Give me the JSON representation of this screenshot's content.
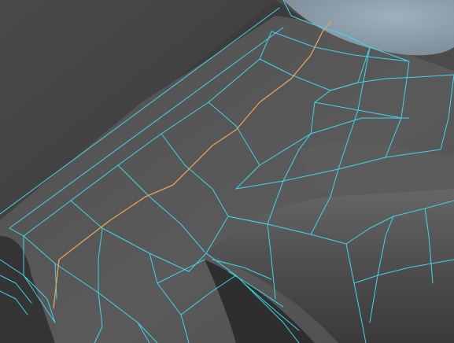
{
  "viewport": {
    "kind": "3d-viewport-wireframe-on-shaded",
    "colors": {
      "background": "#3c3c3c",
      "mesh_dark": "#3e3e3e",
      "mesh_mid": "#505050",
      "mesh_light": "#5f5f5f",
      "mesh_highlight": "#6a6a6a",
      "dome": "#8a9aa8",
      "wireframe": "#3fd6e8",
      "selected_edge": "#e8a25a"
    },
    "selection": {
      "component": "edge-loop",
      "count_visible": 1
    },
    "overlay_text": []
  }
}
